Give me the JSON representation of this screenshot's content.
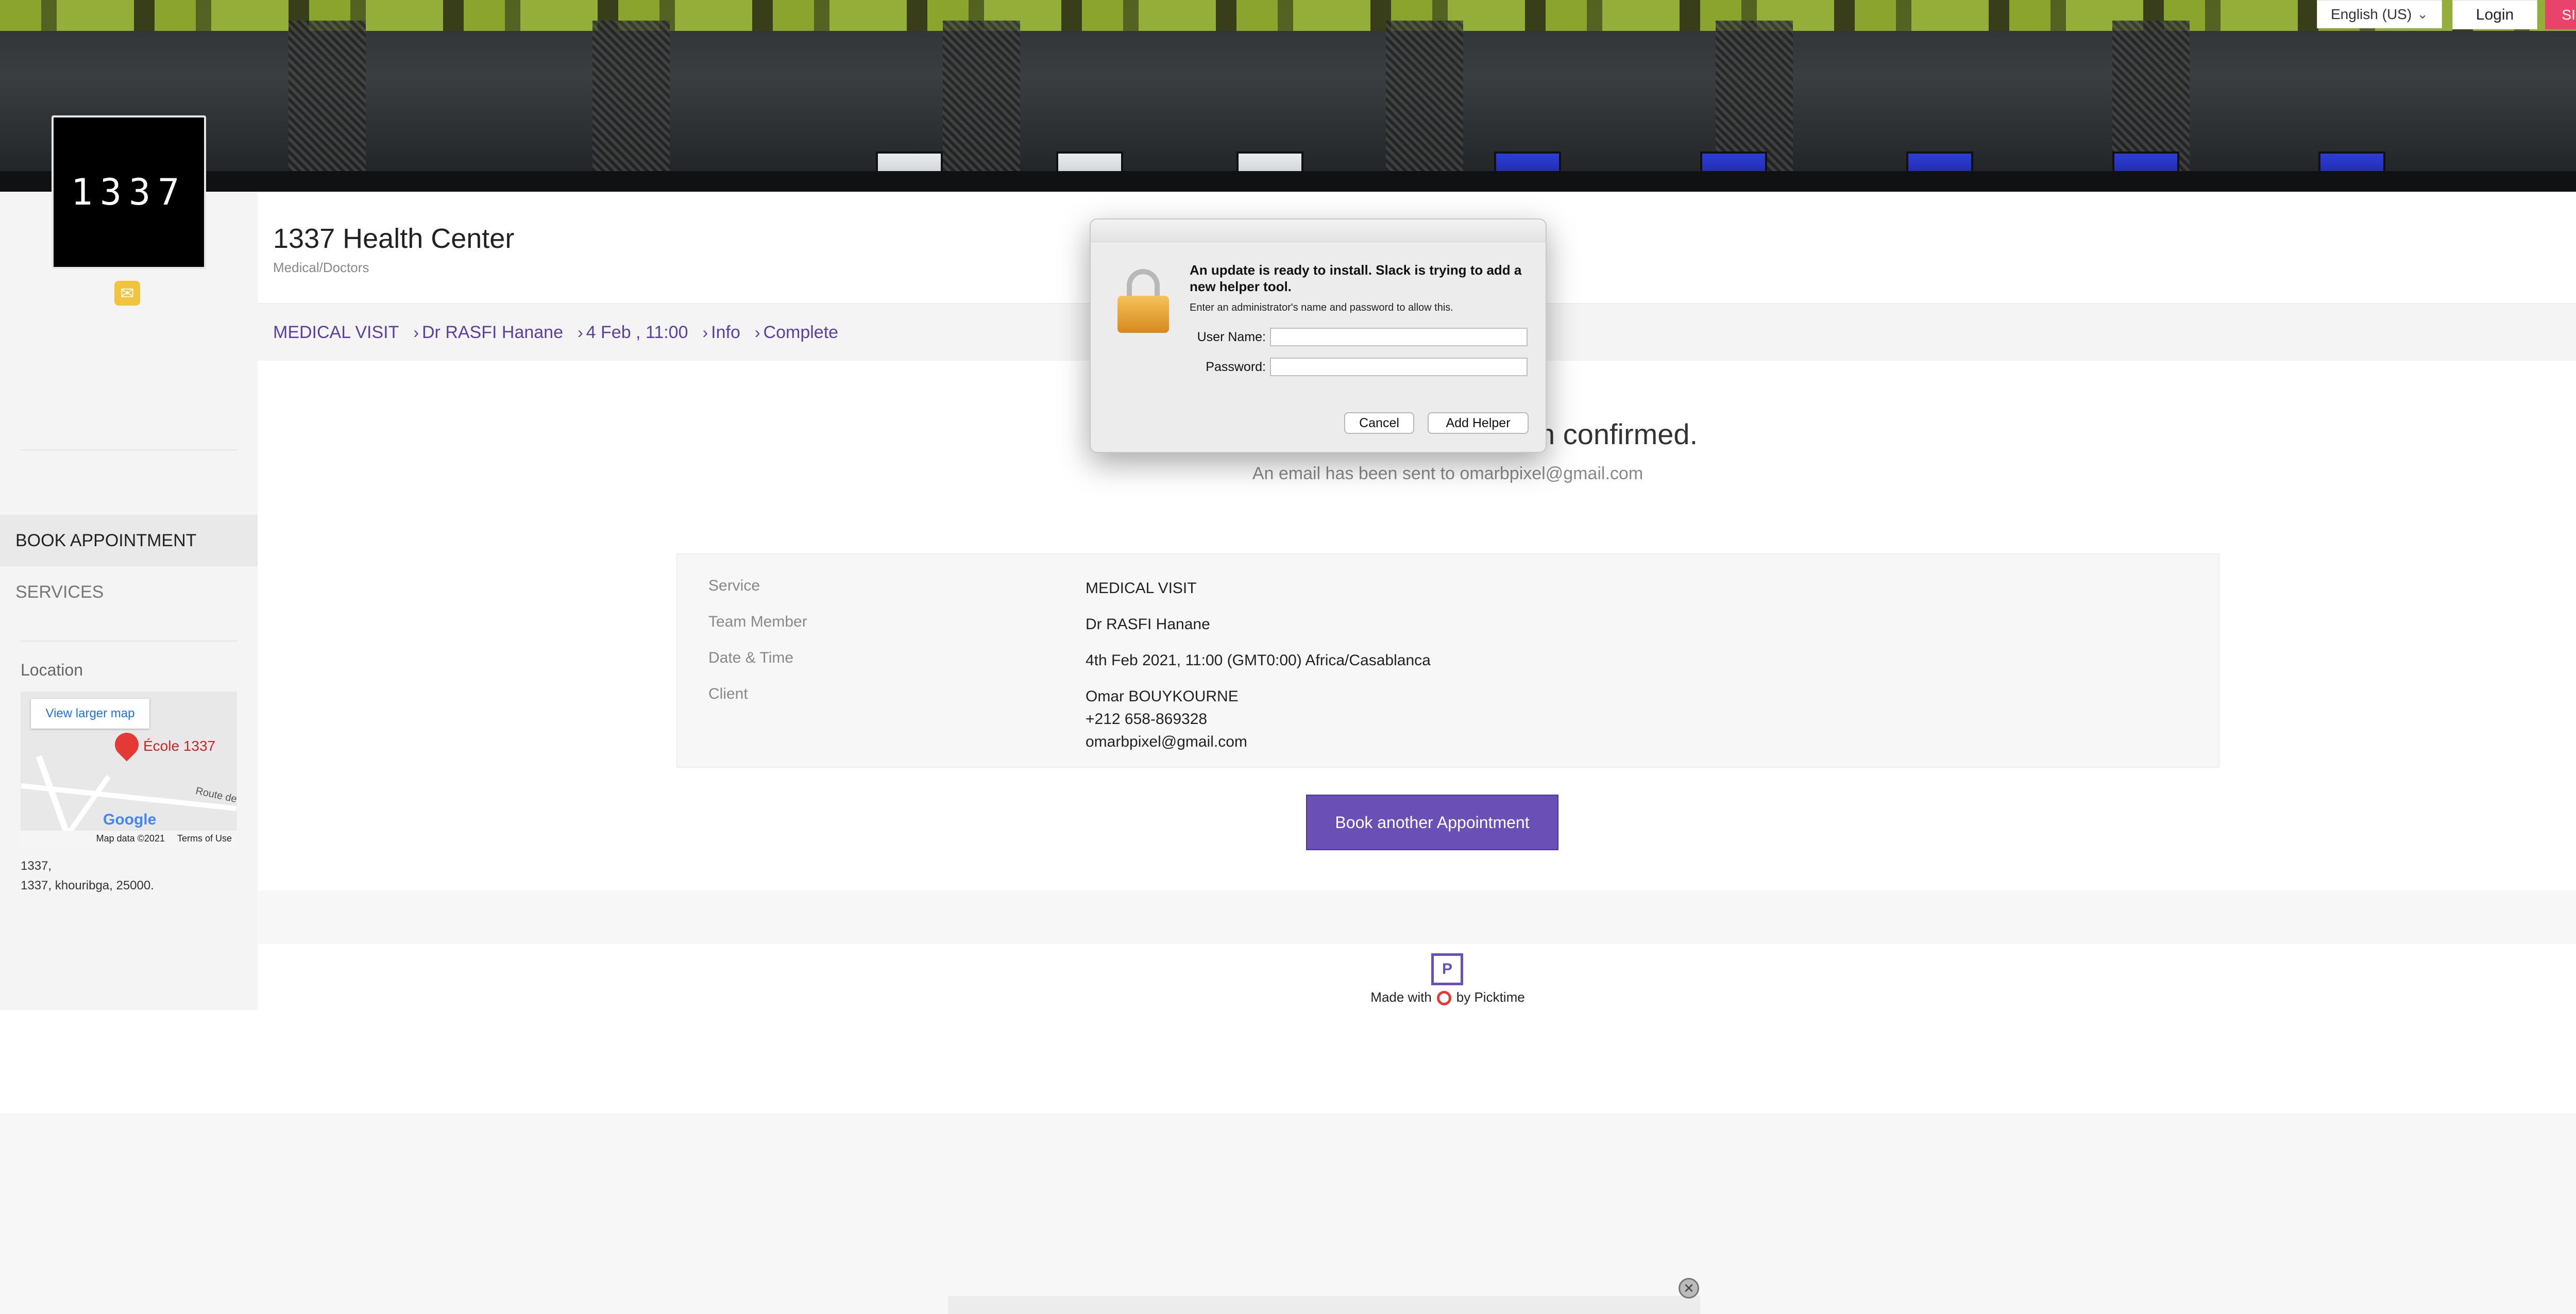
{
  "header": {
    "language": "English (US)",
    "login_label": "Login",
    "signup_label": "SIGN UP"
  },
  "sidebar": {
    "logo_text": "1337",
    "items": [
      {
        "label": "BOOK APPOINTMENT"
      },
      {
        "label": "SERVICES"
      }
    ],
    "location_label": "Location",
    "map": {
      "view_larger": "View larger map",
      "place": "École 1337",
      "google": "Google",
      "map_data": "Map data ©2021",
      "terms": "Terms of Use",
      "route": "Route de",
      "edge_letter": "S"
    },
    "address_line1": "1337,",
    "address_line2": "1337, khouribga, 25000."
  },
  "business": {
    "name": "1337 Health Center",
    "category": "Medical/Doctors"
  },
  "breadcrumbs": [
    {
      "label": "MEDICAL VISIT"
    },
    {
      "label": "Dr RASFI Hanane"
    },
    {
      "label": "4 Feb , 11:00"
    },
    {
      "label": "Info"
    },
    {
      "label": "Complete"
    }
  ],
  "confirmation": {
    "title": "Yay! Your booking has been confirmed.",
    "subtitle": "An email has been sent to omarbpixel@gmail.com",
    "details": [
      {
        "key": "Service",
        "value": "MEDICAL VISIT"
      },
      {
        "key": "Team Member",
        "value": "Dr RASFI Hanane"
      },
      {
        "key": "Date & Time",
        "value": "4th Feb 2021, 11:00 (GMT0:00) Africa/Casablanca"
      },
      {
        "key": "Client",
        "value": "Omar BOUYKOURNE"
      }
    ],
    "client_phone": "+212 658-869328",
    "client_email": "omarbpixel@gmail.com",
    "book_another": "Book another Appointment"
  },
  "footer": {
    "made_with": "Made with",
    "by": "by Picktime"
  },
  "dialog": {
    "title": "An update is ready to install. Slack is trying to add a new helper tool.",
    "text": "Enter an administrator's name and password to allow this.",
    "username_label": "User Name:",
    "password_label": "Password:",
    "cancel_label": "Cancel",
    "add_helper_label": "Add Helper"
  },
  "colors": {
    "accent": "#6a4fb6",
    "signup": "#e8436a",
    "success": "#6bbf5c"
  }
}
